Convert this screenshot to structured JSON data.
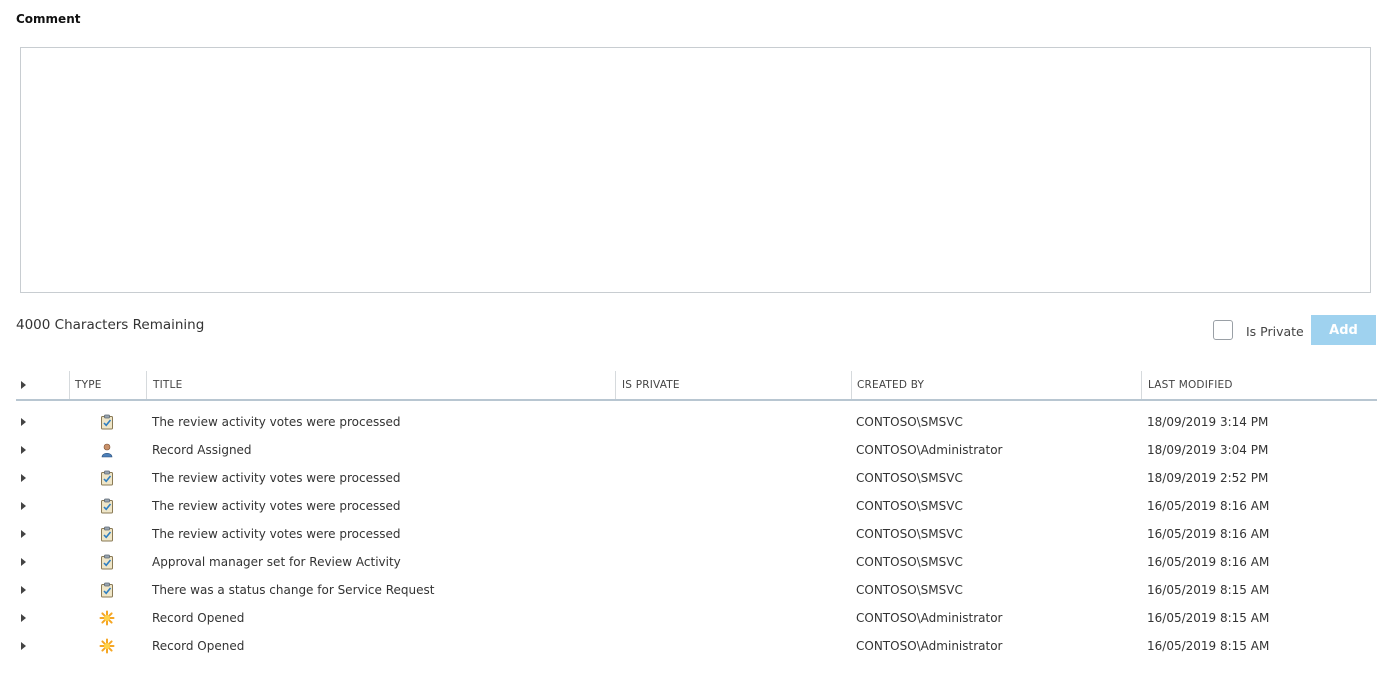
{
  "comment": {
    "label": "Comment",
    "value": "",
    "placeholder": ""
  },
  "chars_remaining": "4000 Characters Remaining",
  "is_private_label": "Is Private",
  "add_label": "Add",
  "colors": {
    "accent_disabled": "#9fd2ef",
    "border": "#c8cdd1",
    "header_underline": "#b8c6d1"
  },
  "grid": {
    "headers": {
      "type": "TYPE",
      "title": "TITLE",
      "is_private": "IS PRIVATE",
      "created_by": "CREATED BY",
      "last_modified": "LAST MODIFIED"
    },
    "rows": [
      {
        "icon": "clipboard-check-icon",
        "title": "The review activity votes were processed",
        "is_private": "",
        "created_by": "CONTOSO\\SMSVC",
        "last_modified": "18/09/2019 3:14 PM"
      },
      {
        "icon": "user-icon",
        "title": "Record Assigned",
        "is_private": "",
        "created_by": "CONTOSO\\Administrator",
        "last_modified": "18/09/2019 3:04 PM"
      },
      {
        "icon": "clipboard-check-icon",
        "title": "The review activity votes were processed",
        "is_private": "",
        "created_by": "CONTOSO\\SMSVC",
        "last_modified": "18/09/2019 2:52 PM"
      },
      {
        "icon": "clipboard-check-icon",
        "title": "The review activity votes were processed",
        "is_private": "",
        "created_by": "CONTOSO\\SMSVC",
        "last_modified": "16/05/2019 8:16 AM"
      },
      {
        "icon": "clipboard-check-icon",
        "title": "The review activity votes were processed",
        "is_private": "",
        "created_by": "CONTOSO\\SMSVC",
        "last_modified": "16/05/2019 8:16 AM"
      },
      {
        "icon": "clipboard-check-icon",
        "title": "Approval manager set for Review Activity",
        "is_private": "",
        "created_by": "CONTOSO\\SMSVC",
        "last_modified": "16/05/2019 8:16 AM"
      },
      {
        "icon": "clipboard-check-icon",
        "title": "There was a status change for Service Request",
        "is_private": "",
        "created_by": "CONTOSO\\SMSVC",
        "last_modified": "16/05/2019 8:15 AM"
      },
      {
        "icon": "starburst-icon",
        "title": "Record Opened",
        "is_private": "",
        "created_by": "CONTOSO\\Administrator",
        "last_modified": "16/05/2019 8:15 AM"
      },
      {
        "icon": "starburst-icon",
        "title": "Record Opened",
        "is_private": "",
        "created_by": "CONTOSO\\Administrator",
        "last_modified": "16/05/2019 8:15 AM"
      }
    ]
  }
}
